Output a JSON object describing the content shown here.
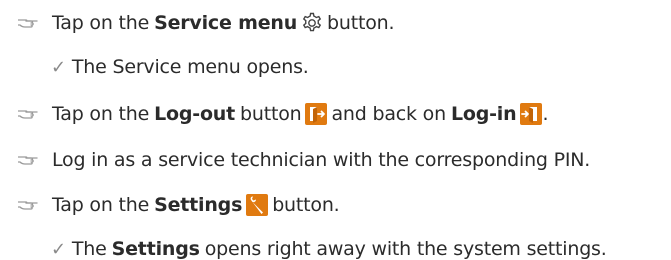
{
  "icons": {
    "pointing_hand": "pointing-hand-icon",
    "check": "check-icon",
    "gear": "gear-icon",
    "logout": "logout-icon",
    "login": "login-icon",
    "wrench": "wrench-icon"
  },
  "colors": {
    "text": "#2b2b2b",
    "bullet": "#9a9a9a",
    "icon_orange": "#e07a10"
  },
  "lines": {
    "l1": {
      "a": "Tap on the",
      "b": "Service menu",
      "c": "button."
    },
    "l2": {
      "check": "✓",
      "a": "The Service menu opens."
    },
    "l3": {
      "a": "Tap on the",
      "b": "Log-out",
      "c": "button",
      "d": "and back on",
      "e": "Log-in",
      "f": "."
    },
    "l4": {
      "a": "Log in as a service technician with the corresponding PIN."
    },
    "l5": {
      "a": "Tap on the",
      "b": "Settings",
      "c": "button."
    },
    "l6": {
      "check": "✓",
      "a": "The",
      "b": "Settings",
      "c": "opens right away with the system settings."
    }
  }
}
